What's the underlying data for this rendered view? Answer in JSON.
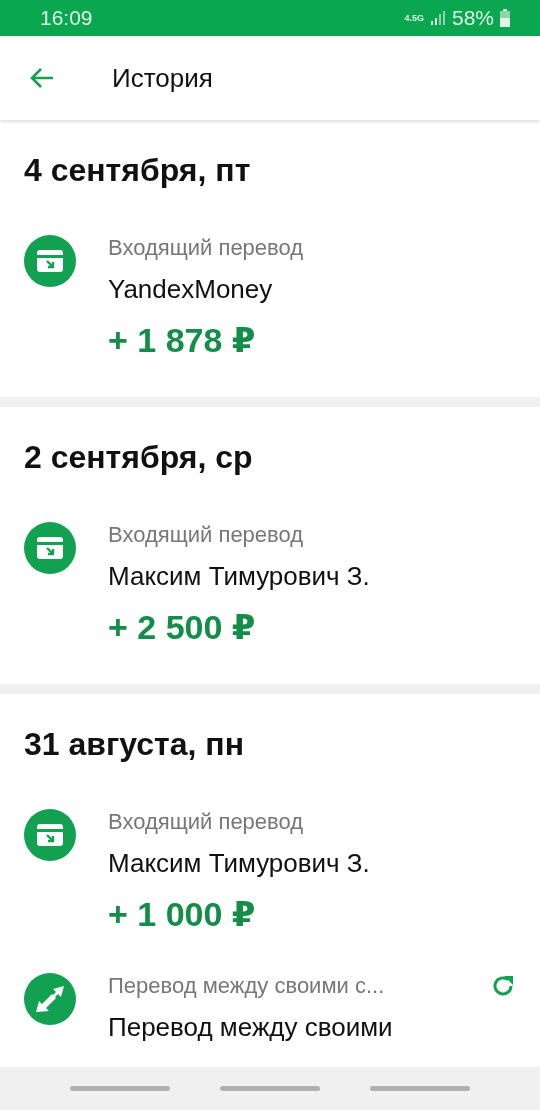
{
  "status_bar": {
    "time": "16:09",
    "network": "4.5G",
    "battery": "58%"
  },
  "header": {
    "title": "История"
  },
  "days": [
    {
      "date": "4 сентября, пт",
      "items": [
        {
          "kind": "incoming",
          "label": "Входящий перевод",
          "name": "YandexMoney",
          "amount": "+ 1 878 ₽",
          "repeat": false
        }
      ]
    },
    {
      "date": "2 сентября, ср",
      "items": [
        {
          "kind": "incoming",
          "label": "Входящий перевод",
          "name": "Максим Тимурович З.",
          "amount": "+ 2 500 ₽",
          "repeat": false
        }
      ]
    },
    {
      "date": "31 августа, пн",
      "items": [
        {
          "kind": "incoming",
          "label": "Входящий перевод",
          "name": "Максим Тимурович З.",
          "amount": "+ 1 000 ₽",
          "repeat": false
        },
        {
          "kind": "transfer",
          "label": "Перевод между своими с...",
          "name": "Перевод между своими",
          "repeat": true
        }
      ]
    }
  ]
}
